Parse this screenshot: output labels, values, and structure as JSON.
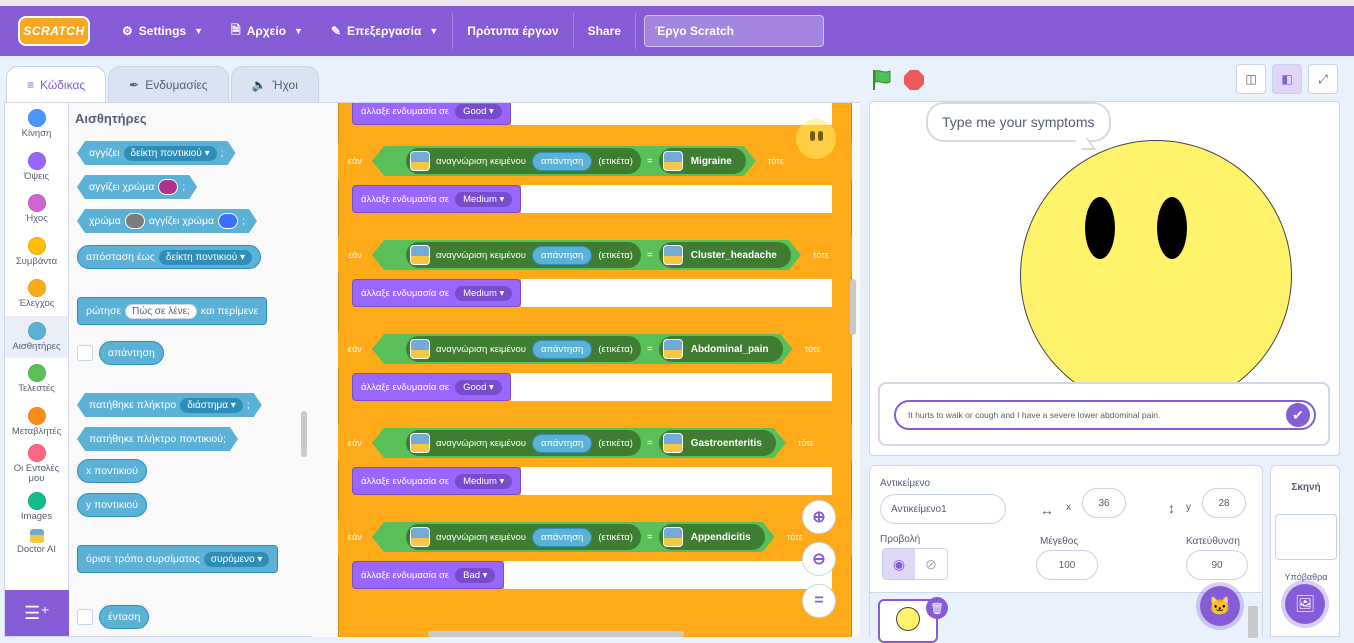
{
  "menu": {
    "logo": "SCRATCH",
    "settings": "Settings",
    "file": "Αρχείο",
    "edit": "Επεξεργασία",
    "tutorials": "Πρότυπα έργων",
    "share": "Share",
    "project_title": "Έργο Scratch"
  },
  "tabs": [
    {
      "label": "Κώδικας",
      "icon": "code-icon"
    },
    {
      "label": "Ενδυμασίες",
      "icon": "brush-icon"
    },
    {
      "label": "Ήχοι",
      "icon": "speaker-icon"
    }
  ],
  "categories": [
    {
      "label": "Κίνηση",
      "color": "#4c97ff"
    },
    {
      "label": "Όψεις",
      "color": "#9966ff"
    },
    {
      "label": "Ήχος",
      "color": "#cf63cf"
    },
    {
      "label": "Συμβάντα",
      "color": "#ffbf00"
    },
    {
      "label": "Έλεγχος",
      "color": "#ffab19"
    },
    {
      "label": "Αισθητήρες",
      "color": "#5cb1d6"
    },
    {
      "label": "Τελεστές",
      "color": "#59c059"
    },
    {
      "label": "Μεταβλητές",
      "color": "#ff8c1a"
    },
    {
      "label": "Οι Εντολές μου",
      "color": "#ff6680"
    },
    {
      "label": "Images",
      "color": "#0fbd8c"
    },
    {
      "label": "Doctor AI",
      "color": "#74a9d8"
    }
  ],
  "palette": {
    "title": "Αισθητήρες",
    "touching": "αγγίζει",
    "mouse_pointer": "δείκτη ποντικιού",
    "touching_color": "αγγίζει χρώμα",
    "color": "χρώμα",
    "touches_color": "αγγίζει χρώμα",
    "distance_to": "απόσταση έως",
    "ask": "ρώτησε",
    "ask_default": "Πώς σε λένε;",
    "and_wait": "και περίμενε",
    "answer": "απάντηση",
    "key_pressed": "πατήθηκε πλήκτρο",
    "space": "διάστημα",
    "mouse_down": "πατήθηκε πλήκτρο ποντικιού;",
    "mouse_x": "x ποντικιού",
    "mouse_y": "y ποντικιού",
    "set_drag_mode": "όρισε τρόπο συρσίματος",
    "draggable": "συρόμενο",
    "loudness": "ένταση",
    "colors": {
      "swatch1": "#b0348f",
      "swatch2": "#7d7d7d",
      "swatch3": "#3d6fff"
    }
  },
  "script": {
    "if_word": "εάν",
    "then_word": "τότε",
    "recognize": "αναγνώριση κειμένου",
    "answer": "απάντηση",
    "label": "(ετικέτα)",
    "switch_costume": "άλλαξε ενδυμασία σε",
    "top_costume": "Good",
    "rows": [
      {
        "label": "Migraine",
        "costume": "Medium"
      },
      {
        "label": "Cluster_headache",
        "costume": "Medium"
      },
      {
        "label": "Abdominal_pain",
        "costume": "Good"
      },
      {
        "label": "Gastroenteritis",
        "costume": "Medium"
      },
      {
        "label": "Appendicitis",
        "costume": "Bad"
      }
    ]
  },
  "stage": {
    "speech": "Type me your symptoms",
    "answer_value": "It hurts to walk or cough and I have a severe lower abdominal pain."
  },
  "sprite_info": {
    "sprite_label": "Αντικείμενο",
    "sprite_name": "Αντικείμενο1",
    "x_label": "x",
    "x_value": "36",
    "y_label": "y",
    "y_value": "28",
    "show_label": "Προβολή",
    "size_label": "Μέγεθος",
    "size_value": "100",
    "direction_label": "Κατεύθυνση",
    "direction_value": "90"
  },
  "stage_pane": {
    "title": "Σκηνή",
    "backdrops_label": "Υπόβαθρα"
  }
}
